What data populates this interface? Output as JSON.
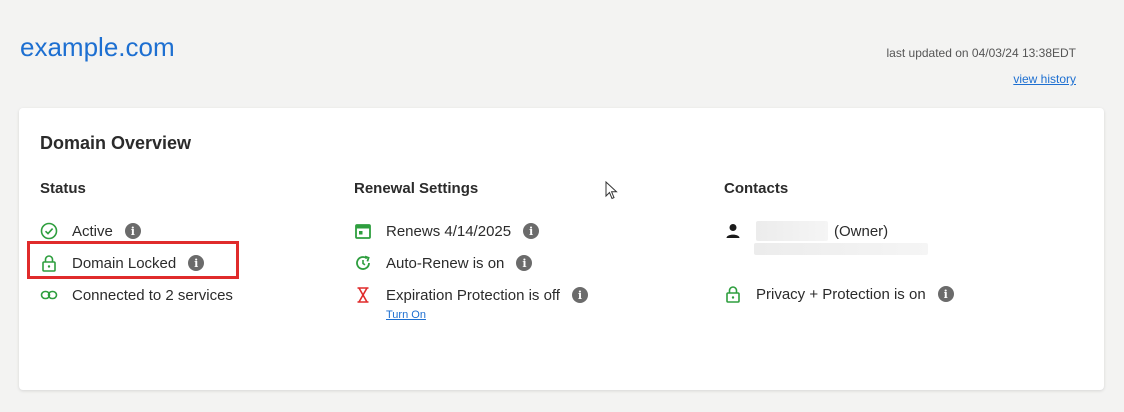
{
  "header": {
    "domain": "example.com",
    "last_updated": "last updated on 04/03/24 13:38EDT",
    "view_history": "view history"
  },
  "overview": {
    "title": "Domain Overview",
    "status": {
      "heading": "Status",
      "items": [
        {
          "label": "Active",
          "icon": "check-circle-icon"
        },
        {
          "label": "Domain Locked",
          "icon": "lock-icon"
        },
        {
          "label": "Connected to 2 services",
          "icon": "link-icon"
        }
      ]
    },
    "renewal": {
      "heading": "Renewal Settings",
      "items": [
        {
          "label": "Renews 4/14/2025",
          "icon": "calendar-icon"
        },
        {
          "label": "Auto-Renew is on",
          "icon": "auto-renew-icon"
        },
        {
          "label": "Expiration Protection is off",
          "icon": "hourglass-icon"
        }
      ],
      "turn_on": "Turn On"
    },
    "contacts": {
      "heading": "Contacts",
      "owner": "(Owner)",
      "privacy": "Privacy + Protection is on"
    }
  },
  "colors": {
    "accent": "#1d6fd1",
    "green": "#2e9e3e",
    "red": "#e02b2b"
  }
}
